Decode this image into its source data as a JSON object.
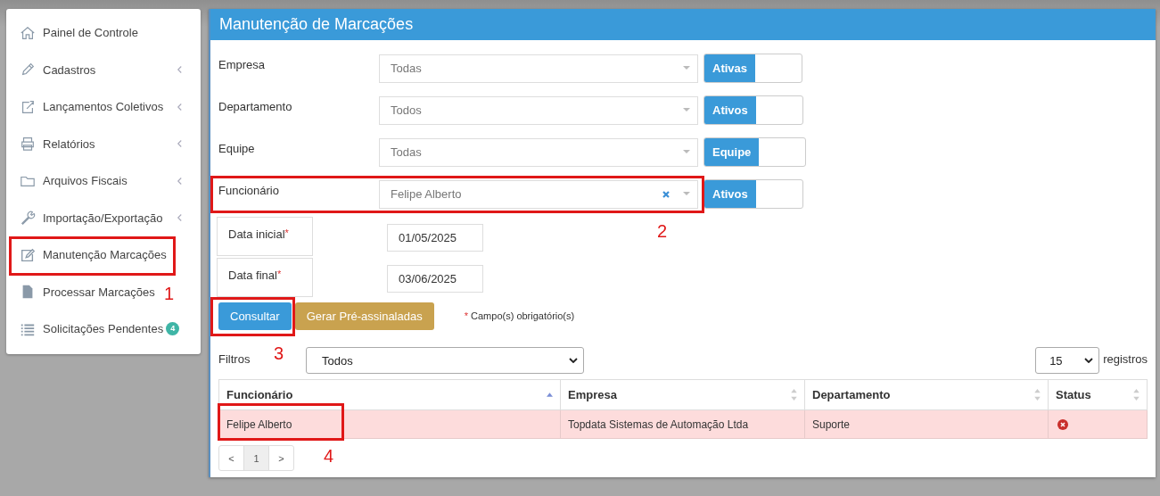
{
  "sidebar": {
    "items": [
      {
        "label": "Painel de Controle",
        "submenu": false
      },
      {
        "label": "Cadastros",
        "submenu": true
      },
      {
        "label": "Lançamentos Coletivos",
        "submenu": true
      },
      {
        "label": "Relatórios",
        "submenu": true
      },
      {
        "label": "Arquivos Fiscais",
        "submenu": true
      },
      {
        "label": "Importação/Exportação",
        "submenu": true
      },
      {
        "label": "Manutenção Marcações",
        "submenu": false,
        "annotation": "1"
      },
      {
        "label": "Processar Marcações",
        "submenu": false
      },
      {
        "label": "Solicitações Pendentes",
        "submenu": false,
        "badge": "4"
      }
    ]
  },
  "panel": {
    "title": "Manutenção de Marcações",
    "fields": [
      {
        "kind": "select",
        "label": "Empresa",
        "value": "Todas",
        "toggle": "Ativas",
        "toggle_on": true
      },
      {
        "kind": "select",
        "label": "Departamento",
        "value": "Todos",
        "toggle": "Ativos",
        "toggle_on": true
      },
      {
        "kind": "select",
        "label": "Equipe",
        "value": "Todas",
        "toggle": "Equipe",
        "toggle_on": true
      },
      {
        "kind": "select",
        "label": "Funcionário",
        "value": "Felipe Alberto",
        "clearable": true,
        "toggle": "Ativos",
        "toggle_on": true,
        "annotation": "2"
      },
      {
        "kind": "date",
        "label": "Data inicial",
        "required": true,
        "value": "01/05/2025"
      },
      {
        "kind": "date",
        "label": "Data final",
        "required": true,
        "value": "03/06/2025"
      }
    ],
    "buttons": [
      {
        "label": "Consultar",
        "kind": "primary",
        "annotation": "3"
      },
      {
        "label": "Gerar Pré-assinaladas",
        "kind": "warning"
      }
    ],
    "required_note": {
      "mark": "*",
      "text": "Campo(s) obrigatório(s)"
    },
    "filter": {
      "label": "Filtros",
      "value": "Todos"
    },
    "page_size": {
      "value": "15",
      "label": "registros"
    },
    "table": {
      "columns": [
        {
          "label": "Funcionário",
          "sorted": true
        },
        {
          "label": "Empresa",
          "sorted": false
        },
        {
          "label": "Departamento",
          "sorted": false
        },
        {
          "label": "Status",
          "sorted": false
        }
      ],
      "rows": [
        {
          "cells": [
            "Felipe Alberto",
            "Topdata Sistemas de Automação Ltda",
            "Suporte"
          ],
          "error": true,
          "annotation": "4"
        }
      ]
    },
    "pagination": {
      "prev": "<",
      "pages": [
        {
          "label": "1",
          "selected": true
        }
      ],
      "next": ">"
    }
  }
}
